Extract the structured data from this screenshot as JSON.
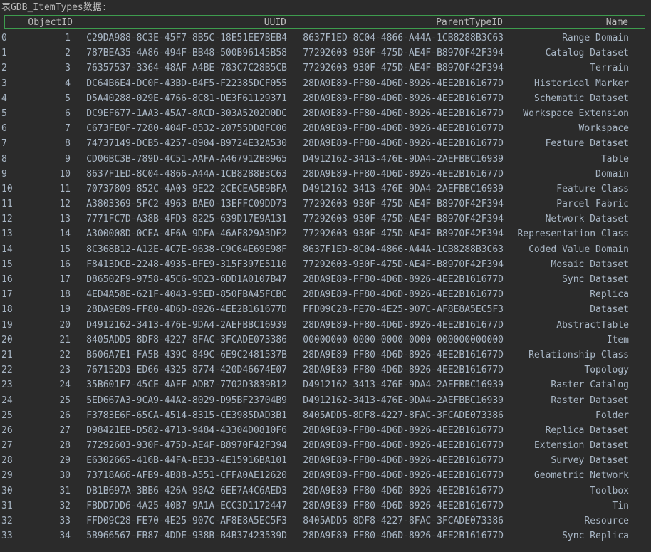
{
  "title": "表GDB_ItemTypes数据:",
  "columns": [
    "ObjectID",
    "UUID",
    "ParentTypeID",
    "Name"
  ],
  "rows": [
    [
      "0",
      "1",
      "C29DA988-8C3E-45F7-8B5C-18E51EE7BEB4",
      "8637F1ED-8C04-4866-A44A-1CB8288B3C63",
      "Range Domain"
    ],
    [
      "1",
      "2",
      "787BEA35-4A86-494F-BB48-500B96145B58",
      "77292603-930F-475D-AE4F-B8970F42F394",
      "Catalog Dataset"
    ],
    [
      "2",
      "3",
      "76357537-3364-48AF-A4BE-783C7C28B5CB",
      "77292603-930F-475D-AE4F-B8970F42F394",
      "Terrain"
    ],
    [
      "3",
      "4",
      "DC64B6E4-DC0F-43BD-B4F5-F22385DCF055",
      "28DA9E89-FF80-4D6D-8926-4EE2B161677D",
      "Historical Marker"
    ],
    [
      "4",
      "5",
      "D5A40288-029E-4766-8C81-DE3F61129371",
      "28DA9E89-FF80-4D6D-8926-4EE2B161677D",
      "Schematic Dataset"
    ],
    [
      "5",
      "6",
      "DC9EF677-1AA3-45A7-8ACD-303A5202D0DC",
      "28DA9E89-FF80-4D6D-8926-4EE2B161677D",
      "Workspace Extension"
    ],
    [
      "6",
      "7",
      "C673FE0F-7280-404F-8532-20755DD8FC06",
      "28DA9E89-FF80-4D6D-8926-4EE2B161677D",
      "Workspace"
    ],
    [
      "7",
      "8",
      "74737149-DCB5-4257-8904-B9724E32A530",
      "28DA9E89-FF80-4D6D-8926-4EE2B161677D",
      "Feature Dataset"
    ],
    [
      "8",
      "9",
      "CD06BC3B-789D-4C51-AAFA-A467912B8965",
      "D4912162-3413-476E-9DA4-2AEFBBC16939",
      "Table"
    ],
    [
      "9",
      "10",
      "8637F1ED-8C04-4866-A44A-1CB8288B3C63",
      "28DA9E89-FF80-4D6D-8926-4EE2B161677D",
      "Domain"
    ],
    [
      "10",
      "11",
      "70737809-852C-4A03-9E22-2CECEA5B9BFA",
      "D4912162-3413-476E-9DA4-2AEFBBC16939",
      "Feature Class"
    ],
    [
      "11",
      "12",
      "A3803369-5FC2-4963-BAE0-13EFFC09DD73",
      "77292603-930F-475D-AE4F-B8970F42F394",
      "Parcel Fabric"
    ],
    [
      "12",
      "13",
      "7771FC7D-A38B-4FD3-8225-639D17E9A131",
      "77292603-930F-475D-AE4F-B8970F42F394",
      "Network Dataset"
    ],
    [
      "13",
      "14",
      "A300008D-0CEA-4F6A-9DFA-46AF829A3DF2",
      "77292603-930F-475D-AE4F-B8970F42F394",
      "Representation Class"
    ],
    [
      "14",
      "15",
      "8C368B12-A12E-4C7E-9638-C9C64E69E98F",
      "8637F1ED-8C04-4866-A44A-1CB8288B3C63",
      "Coded Value Domain"
    ],
    [
      "15",
      "16",
      "F8413DCB-2248-4935-BFE9-315F397E5110",
      "77292603-930F-475D-AE4F-B8970F42F394",
      "Mosaic Dataset"
    ],
    [
      "16",
      "17",
      "D86502F9-9758-45C6-9D23-6DD1A0107B47",
      "28DA9E89-FF80-4D6D-8926-4EE2B161677D",
      "Sync Dataset"
    ],
    [
      "17",
      "18",
      "4ED4A58E-621F-4043-95ED-850FBA45FCBC",
      "28DA9E89-FF80-4D6D-8926-4EE2B161677D",
      "Replica"
    ],
    [
      "18",
      "19",
      "28DA9E89-FF80-4D6D-8926-4EE2B161677D",
      "FFD09C28-FE70-4E25-907C-AF8E8A5EC5F3",
      "Dataset"
    ],
    [
      "19",
      "20",
      "D4912162-3413-476E-9DA4-2AEFBBC16939",
      "28DA9E89-FF80-4D6D-8926-4EE2B161677D",
      "AbstractTable"
    ],
    [
      "20",
      "21",
      "8405ADD5-8DF8-4227-8FAC-3FCADE073386",
      "00000000-0000-0000-0000-000000000000",
      "Item"
    ],
    [
      "21",
      "22",
      "B606A7E1-FA5B-439C-849C-6E9C2481537B",
      "28DA9E89-FF80-4D6D-8926-4EE2B161677D",
      "Relationship Class"
    ],
    [
      "22",
      "23",
      "767152D3-ED66-4325-8774-420D46674E07",
      "28DA9E89-FF80-4D6D-8926-4EE2B161677D",
      "Topology"
    ],
    [
      "23",
      "24",
      "35B601F7-45CE-4AFF-ADB7-7702D3839B12",
      "D4912162-3413-476E-9DA4-2AEFBBC16939",
      "Raster Catalog"
    ],
    [
      "24",
      "25",
      "5ED667A3-9CA9-44A2-8029-D95BF23704B9",
      "D4912162-3413-476E-9DA4-2AEFBBC16939",
      "Raster Dataset"
    ],
    [
      "25",
      "26",
      "F3783E6F-65CA-4514-8315-CE3985DAD3B1",
      "8405ADD5-8DF8-4227-8FAC-3FCADE073386",
      "Folder"
    ],
    [
      "26",
      "27",
      "D98421EB-D582-4713-9484-43304D0810F6",
      "28DA9E89-FF80-4D6D-8926-4EE2B161677D",
      "Replica Dataset"
    ],
    [
      "27",
      "28",
      "77292603-930F-475D-AE4F-B8970F42F394",
      "28DA9E89-FF80-4D6D-8926-4EE2B161677D",
      "Extension Dataset"
    ],
    [
      "28",
      "29",
      "E6302665-416B-44FA-BE33-4E15916BA101",
      "28DA9E89-FF80-4D6D-8926-4EE2B161677D",
      "Survey Dataset"
    ],
    [
      "29",
      "30",
      "73718A66-AFB9-4B88-A551-CFFA0AE12620",
      "28DA9E89-FF80-4D6D-8926-4EE2B161677D",
      "Geometric Network"
    ],
    [
      "30",
      "31",
      "DB1B697A-3BB6-426A-98A2-6EE7A4C6AED3",
      "28DA9E89-FF80-4D6D-8926-4EE2B161677D",
      "Toolbox"
    ],
    [
      "31",
      "32",
      "FBDD7DD6-4A25-40B7-9A1A-ECC3D1172447",
      "28DA9E89-FF80-4D6D-8926-4EE2B161677D",
      "Tin"
    ],
    [
      "32",
      "33",
      "FFD09C28-FE70-4E25-907C-AF8E8A5EC5F3",
      "8405ADD5-8DF8-4227-8FAC-3FCADE073386",
      "Resource"
    ],
    [
      "33",
      "34",
      "5B966567-FB87-4DDE-938B-B4B37423539D",
      "28DA9E89-FF80-4D6D-8926-4EE2B161677D",
      "Sync Replica"
    ]
  ]
}
